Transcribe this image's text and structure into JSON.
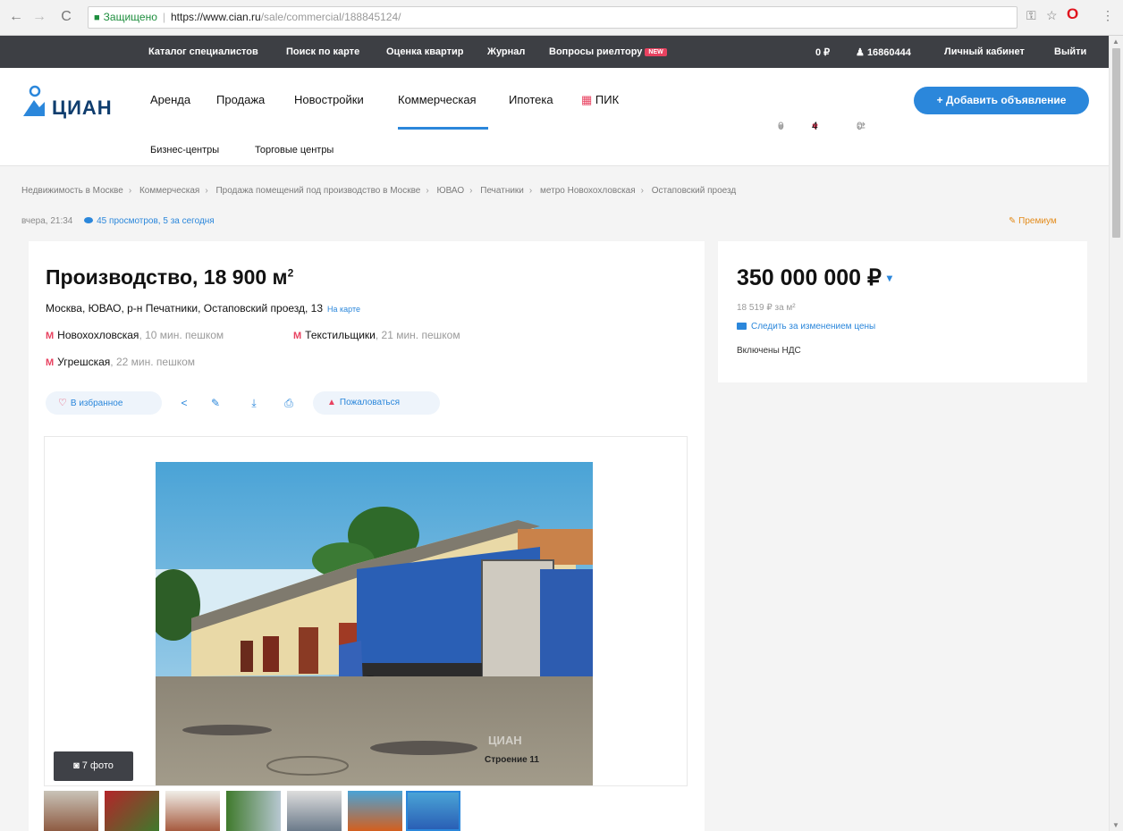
{
  "browser": {
    "secure_label": "Защищено",
    "url_host": "https://www.cian.ru",
    "url_path": "/sale/commercial/188845124/"
  },
  "topbar": {
    "items": [
      "Каталог специалистов",
      "Поиск по карте",
      "Оценка квартир",
      "Журнал",
      "Вопросы риелтору"
    ],
    "new_badge": "NEW",
    "balance": "0 ₽",
    "user_id": "16860444",
    "cabinet": "Личный кабинет",
    "logout": "Выйти"
  },
  "header": {
    "logo_text": "ЦИАН",
    "nav": [
      "Аренда",
      "Продажа",
      "Новостройки",
      "Коммерческая",
      "Ипотека",
      "ПИК"
    ],
    "subnav": [
      "Бизнес-центры",
      "Торговые центры"
    ],
    "chat_count": "0",
    "fav_count": "4",
    "compare_count": "0",
    "add_button": "+ Добавить объявление"
  },
  "breadcrumbs": [
    "Недвижимость в Москве",
    "Коммерческая",
    "Продажа помещений под производство в Москве",
    "ЮВАО",
    "Печатники",
    "метро Новохохловская",
    "Остаповский проезд"
  ],
  "meta": {
    "updated": "вчера, 21:34",
    "views": "45 просмотров, 5 за сегодня",
    "premium": "Премиум"
  },
  "offer": {
    "title": "Производство, 18 900 м",
    "title_sup": "2",
    "address": "Москва, ЮВАО, р-н Печатники, Остаповский проезд, 13",
    "map_link": "На карте",
    "metros": [
      {
        "name": "Новохохловская",
        "dist": "10 мин. пешком"
      },
      {
        "name": "Текстильщики",
        "dist": "21 мин. пешком"
      },
      {
        "name": "Угрешская",
        "dist": "22 мин. пешком"
      }
    ],
    "favorite_label": "В избранное",
    "complain_label": "Пожаловаться",
    "photo_count": "7 фото",
    "photo_caption": "Строение 11",
    "watermark": "ЦИАН"
  },
  "price_card": {
    "price": "350 000 000 ₽",
    "per_m": "18 519 ₽ за м²",
    "follow": "Следить за изменением цены",
    "vat": "Включены НДС"
  },
  "colors": {
    "accent": "#2b87db",
    "metro": "#e84260",
    "topbar": "#3d3f44",
    "premium": "#e38b1a"
  }
}
